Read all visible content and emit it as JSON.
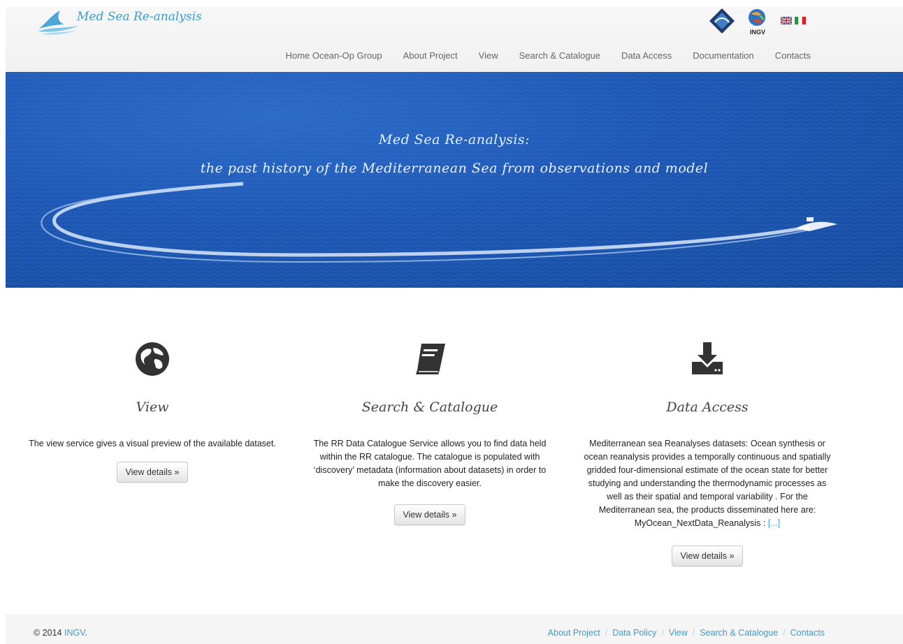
{
  "header": {
    "logo_text": "Med Sea Re-analysis",
    "partner_label": "INGV",
    "nav": [
      "Home Ocean-Op Group",
      "About Project",
      "View",
      "Search & Catalogue",
      "Data Access",
      "Documentation",
      "Contacts"
    ]
  },
  "hero": {
    "line1": "Med Sea Re-analysis:",
    "line2": "the past history of the Mediterranean Sea from observations and model"
  },
  "columns": [
    {
      "icon": "globe-icon",
      "title": "View",
      "text": "The view service gives a visual preview of the available dataset.",
      "button": "View details »"
    },
    {
      "icon": "book-icon",
      "title": "Search & Catalogue",
      "text": "The RR Data Catalogue Service allows you to find data held within the RR catalogue. The catalogue is populated with ‘discovery’ metadata (information about datasets) in order to make the discovery easier.",
      "button": "View details »"
    },
    {
      "icon": "download-icon",
      "title": "Data Access",
      "text": "Mediterranean sea Reanalyses datasets: Ocean synthesis or ocean reanalysis provides a temporally continuous and spatially gridded four-dimensional estimate of the ocean state for better studying and understanding the thermodynamic processes as well as their spatial and temporal variability . For the Mediterranean sea, the products disseminated here are: MyOcean_NextData_Reanalysis :",
      "more": "[...]",
      "button": "View details »"
    }
  ],
  "footer": {
    "copyright": "© 2014",
    "org": "INGV",
    "org_suffix": ".",
    "links": [
      "About Project",
      "Data Policy",
      "View",
      "Search & Catalogue",
      "Contacts"
    ],
    "separator": "/"
  },
  "colors": {
    "accent": "#3a9bd0",
    "sea": "#1e58b4"
  }
}
